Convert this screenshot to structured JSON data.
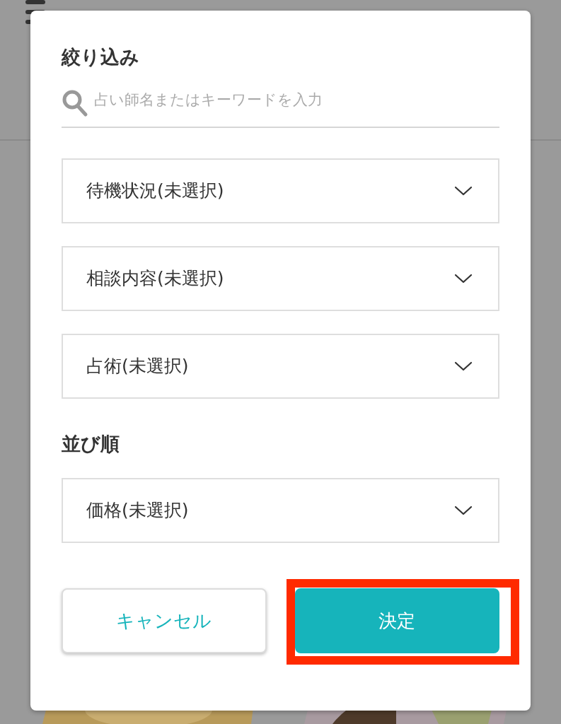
{
  "dialog": {
    "filter_title": "絞り込み",
    "search": {
      "placeholder": "占い師名またはキーワードを入力"
    },
    "filters": [
      {
        "label": "待機状況(未選択)"
      },
      {
        "label": "相談内容(未選択)"
      },
      {
        "label": "占術(未選択)"
      }
    ],
    "sort_title": "並び順",
    "sort": {
      "label": "価格(未選択)"
    },
    "buttons": [
      {
        "label": "キャンセル",
        "kind": "secondary",
        "highlighted": false
      },
      {
        "label": "決定",
        "kind": "primary",
        "highlighted": true
      }
    ]
  }
}
